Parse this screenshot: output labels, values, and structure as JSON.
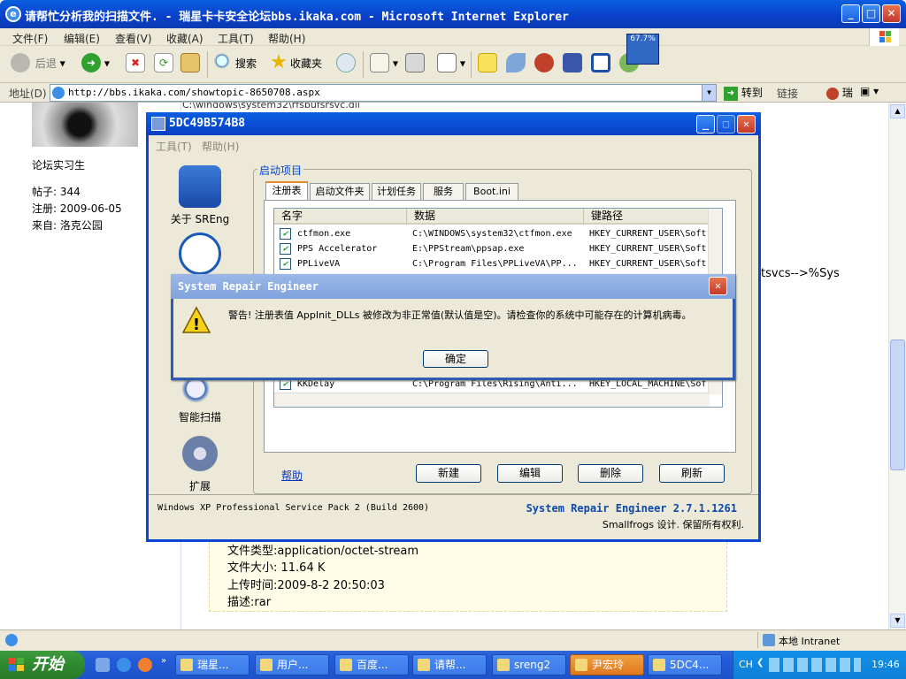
{
  "ie": {
    "title": "请帮忙分析我的扫描文件. - 瑞星卡卡安全论坛bbs.ikaka.com - Microsoft Internet Explorer",
    "menu": [
      "文件(F)",
      "编辑(E)",
      "查看(V)",
      "收藏(A)",
      "工具(T)",
      "帮助(H)"
    ],
    "toolbar": {
      "back": "后退",
      "search": "搜索",
      "favorites": "收藏夹",
      "progress": "67.7%"
    },
    "address_label": "地址(D)",
    "url": "http://bbs.ikaka.com/showtopic-8650708.aspx",
    "go": "转到",
    "links": "链接",
    "rising": "瑞",
    "status_zone": "本地 Intranet"
  },
  "forum": {
    "path_fragment": "C:\\windows\\system32\\rfsbufsrsvc.dll",
    "rank": "论坛实习生",
    "posts": "帖子: 344",
    "reg": "注册: 2009-06-05",
    "from": "来自: 洛克公园",
    "right_text": "tsvcs-->%Sys",
    "file_type": "文件类型:application/octet-stream",
    "file_size": "文件大小: 11.64 K",
    "upload_time": "上传时间:2009-8-2 20:50:03",
    "desc": "描述:rar"
  },
  "sre": {
    "title": "5DC49B574B8",
    "menu": [
      "工具(T)",
      "帮助(H)"
    ],
    "nav": [
      "关于 SREng",
      "智能扫描",
      "扩展"
    ],
    "group": "启动项目",
    "tabs": [
      "注册表",
      "启动文件夹",
      "计划任务",
      "服务",
      "Boot.ini"
    ],
    "cols": [
      "名字",
      "数据",
      "键路径"
    ],
    "rows": [
      {
        "name": "ctfmon.exe",
        "data": "C:\\WINDOWS\\system32\\ctfmon.exe",
        "key": "HKEY_CURRENT_USER\\Soft"
      },
      {
        "name": "PPS Accelerator",
        "data": "E:\\PPStream\\ppsap.exe",
        "key": "HKEY_CURRENT_USER\\Soft"
      },
      {
        "name": "PPLiveVA",
        "data": "C:\\Program Files\\PPLiveVA\\PP...",
        "key": "HKEY_CURRENT_USER\\Soft"
      },
      {
        "name": "KKDelay",
        "data": "C:\\Program Files\\Rising\\Anti...",
        "key": "HKEY_LOCAL_MACHINE\\Sof"
      }
    ],
    "help": "帮助",
    "buttons": [
      "新建",
      "编辑",
      "删除",
      "刷新"
    ],
    "footer_left": "Windows XP Professional Service Pack 2 (Build 2600)",
    "footer_right": "System Repair Engineer 2.7.1.1261",
    "footer_right2": "Smallfrogs 设计. 保留所有权利."
  },
  "alert": {
    "title": "System Repair Engineer",
    "message": "警告! 注册表值 AppInit_DLLs 被修改为非正常值(默认值是空)。请检查你的系统中可能存在的计算机病毒。",
    "ok": "确定"
  },
  "taskbar": {
    "start": "开始",
    "tasks": [
      "瑞星...",
      "用户...",
      "百度...",
      "请帮...",
      "sreng2",
      "尹宏玲",
      "5DC4..."
    ],
    "lang": "CH",
    "clock": "19:46"
  }
}
